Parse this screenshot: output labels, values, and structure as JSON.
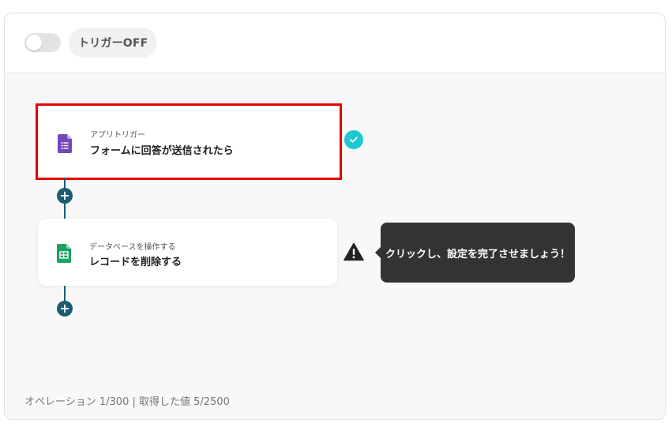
{
  "header": {
    "toggle_state": "off",
    "trigger_label": "トリガーOFF"
  },
  "flow": {
    "steps": [
      {
        "subtitle": "アプリトリガー",
        "title": "フォームに回答が送信されたら",
        "icon": "google-forms-icon",
        "status": "complete",
        "highlight_color": "#e60000"
      },
      {
        "subtitle": "データベースを操作する",
        "title": "レコードを削除する",
        "icon": "google-sheets-icon",
        "status": "warning"
      }
    ],
    "tooltip": "クリックし、設定を完了させましょう！"
  },
  "footer": {
    "stats": "オペレーション 1/300 | 取得した値 5/2500"
  },
  "colors": {
    "accent": "#1a5c72",
    "check": "#1ec8d2",
    "forms_purple": "#7248b9",
    "sheets_green": "#1aa260",
    "tooltip_bg": "#333333"
  }
}
